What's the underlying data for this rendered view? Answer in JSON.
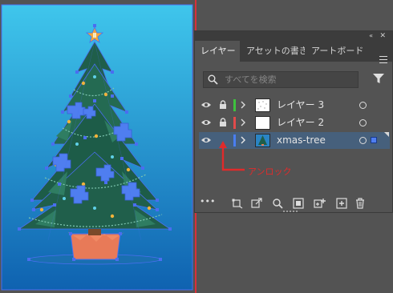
{
  "panel": {
    "tabs": [
      {
        "label": "レイヤー",
        "active": true
      },
      {
        "label": "アセットの書き出"
      },
      {
        "label": "アートボード"
      }
    ],
    "search": {
      "placeholder": "すべてを検索"
    },
    "layers": [
      {
        "name": "レイヤー 3",
        "color": "#3ec23e",
        "locked": true,
        "thumb": "dots"
      },
      {
        "name": "レイヤー 2",
        "color": "#e14b4b",
        "locked": true,
        "thumb": "blank"
      },
      {
        "name": "xmas-tree",
        "color": "#4a7ef0",
        "locked": false,
        "selected": true,
        "thumb": "tree"
      }
    ],
    "icons": [
      "options-icon",
      "collect-export-icon",
      "export-icon",
      "locate-object-icon",
      "clipping-mask-icon",
      "new-sublayer-icon",
      "new-layer-icon",
      "delete-icon"
    ]
  },
  "annotation": {
    "text": "アンロック",
    "color": "#e02b2b"
  },
  "colors": {
    "artboard_top": "#3fc6ec",
    "artboard_bottom": "#1068b4",
    "selection": "#4a6ef0"
  }
}
